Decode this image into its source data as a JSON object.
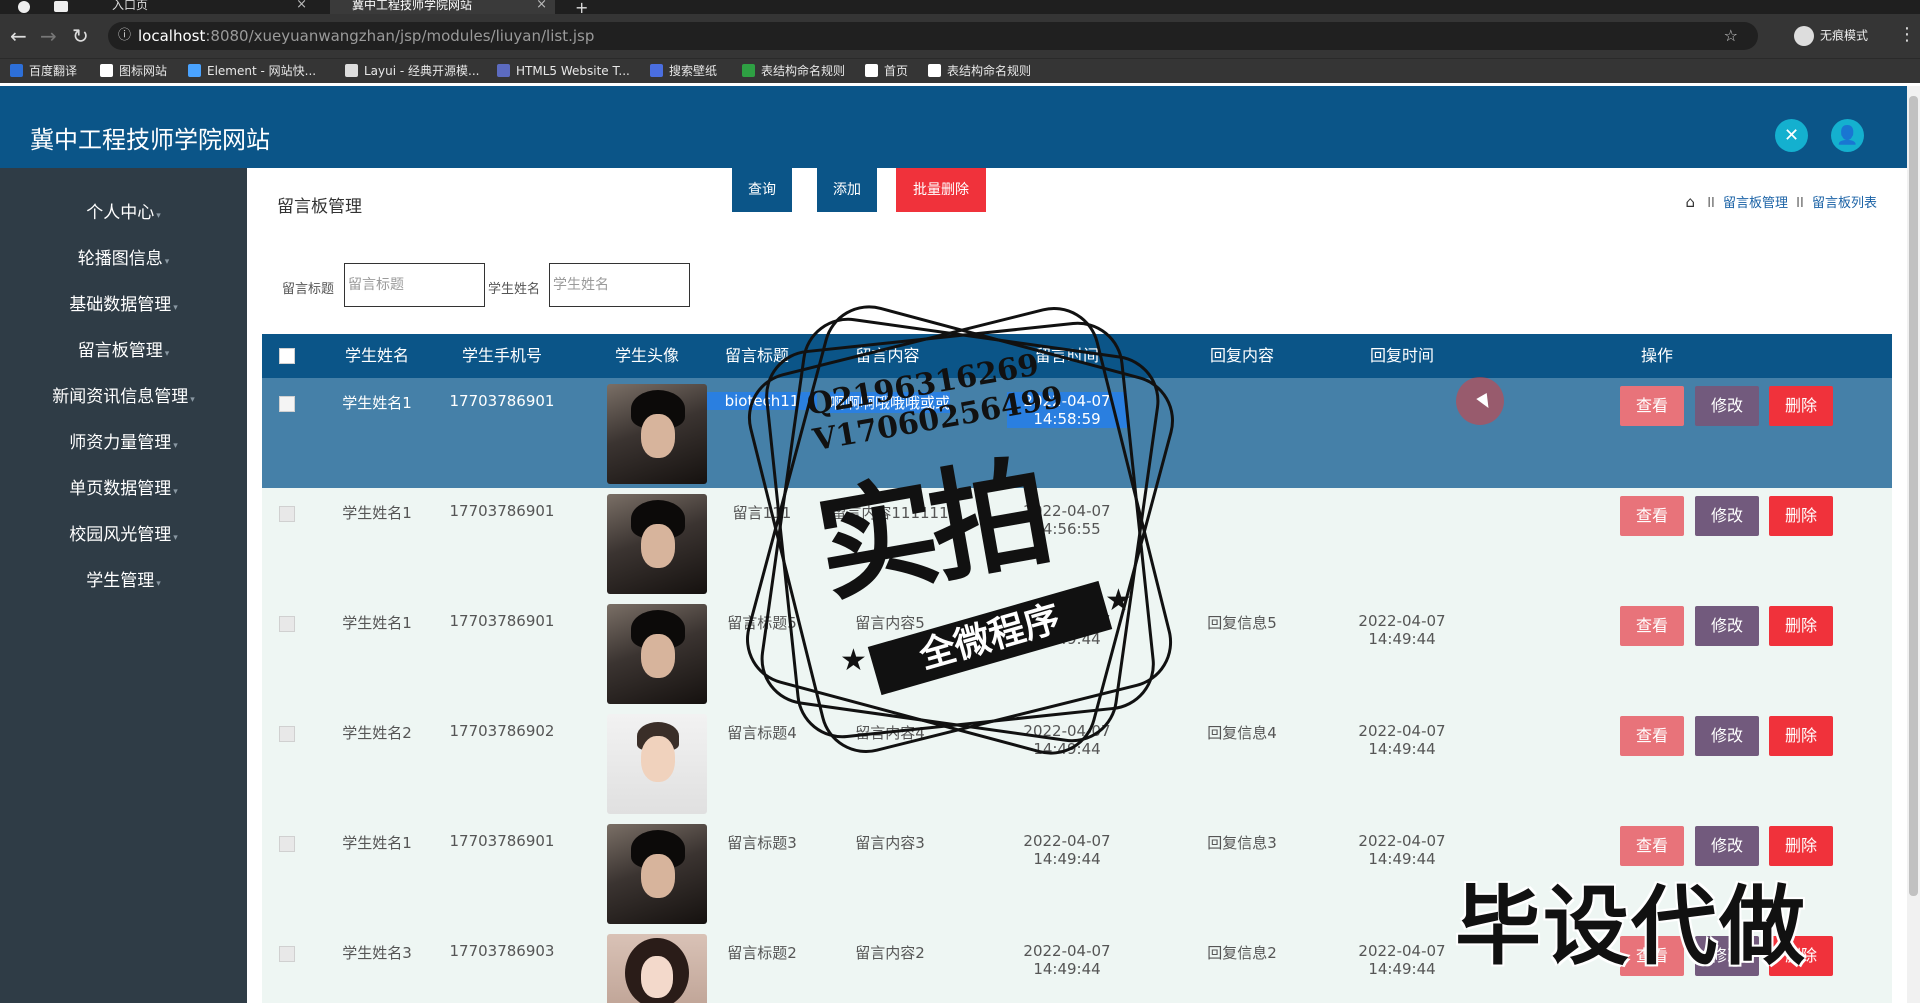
{
  "browser": {
    "tabs": [
      {
        "title": "入口页"
      },
      {
        "title": "冀中工程技师学院网站"
      }
    ],
    "url": {
      "host": "localhost",
      "path": ":8080/xueyuanwangzhan/jsp/modules/liuyan/list.jsp"
    },
    "incognito_label": "无痕模式",
    "bookmarks": [
      {
        "label": "百度翻译",
        "color": "#2d6fd8"
      },
      {
        "label": "图标网站",
        "color": "#ffffff"
      },
      {
        "label": "Element - 网站快...",
        "color": "#4aa3ff"
      },
      {
        "label": "Layui - 经典开源模...",
        "color": "#dddddd"
      },
      {
        "label": "HTML5 Website T...",
        "color": "#5c6bc0"
      },
      {
        "label": "搜索壁纸",
        "color": "#4a6ee0"
      },
      {
        "label": "表结构命名规则",
        "color": "#2ea043"
      },
      {
        "label": "首页",
        "color": "#ffffff"
      },
      {
        "label": "表结构命名规则",
        "color": "#ffffff"
      }
    ]
  },
  "header": {
    "site_title": "冀中工程技师学院网站",
    "accent": "#0b5588",
    "button_color": "#14b0cf"
  },
  "sidebar": {
    "items": [
      {
        "label": "个人中心"
      },
      {
        "label": "轮播图信息"
      },
      {
        "label": "基础数据管理"
      },
      {
        "label": "留言板管理"
      },
      {
        "label": "新闻资讯信息管理"
      },
      {
        "label": "师资力量管理"
      },
      {
        "label": "单页数据管理"
      },
      {
        "label": "校园风光管理"
      },
      {
        "label": "学生管理"
      }
    ]
  },
  "main": {
    "page_title": "留言板管理",
    "breadcrumb": [
      "留言板管理",
      "留言板列表"
    ],
    "breadcrumb_sep": "II",
    "filters": {
      "title_label": "留言标题",
      "title_placeholder": "留言标题",
      "name_label": "学生姓名",
      "name_placeholder": "学生姓名"
    },
    "buttons": {
      "query": "查询",
      "add": "添加",
      "batch_delete": "批量删除"
    },
    "table": {
      "headers": [
        "学生姓名",
        "学生手机号",
        "学生头像",
        "留言标题",
        "留言内容",
        "留言时间",
        "回复内容",
        "回复时间",
        "操作"
      ],
      "actions": {
        "view": "查看",
        "edit": "修改",
        "delete": "删除"
      },
      "rows": [
        {
          "name": "学生姓名1",
          "phone": "17703786901",
          "avatar": "dark",
          "title": "biotech11",
          "content": "啊啊啊哦哦哦或或",
          "time": "2022-04-07 14:58:59",
          "reply": "",
          "reply_time": "",
          "selected": true
        },
        {
          "name": "学生姓名1",
          "phone": "17703786901",
          "avatar": "dark",
          "title": "留言111",
          "content": "留言内容111111",
          "time": "2022-04-07 14:56:55",
          "reply": "",
          "reply_time": "",
          "selected": false
        },
        {
          "name": "学生姓名1",
          "phone": "17703786901",
          "avatar": "dark",
          "title": "留言标题5",
          "content": "留言内容5",
          "time": "2022-04-07 14:49:44",
          "reply": "回复信息5",
          "reply_time": "2022-04-07 14:49:44",
          "selected": false
        },
        {
          "name": "学生姓名2",
          "phone": "17703786902",
          "avatar": "light",
          "title": "留言标题4",
          "content": "留言内容4",
          "time": "2022-04-07 14:49:44",
          "reply": "回复信息4",
          "reply_time": "2022-04-07 14:49:44",
          "selected": false
        },
        {
          "name": "学生姓名1",
          "phone": "17703786901",
          "avatar": "dark",
          "title": "留言标题3",
          "content": "留言内容3",
          "time": "2022-04-07 14:49:44",
          "reply": "回复信息3",
          "reply_time": "2022-04-07 14:49:44",
          "selected": false
        },
        {
          "name": "学生姓名3",
          "phone": "17703786903",
          "avatar": "girl",
          "title": "留言标题2",
          "content": "留言内容2",
          "time": "2022-04-07 14:49:44",
          "reply": "回复信息2",
          "reply_time": "2022-04-07 14:49:44",
          "selected": false
        }
      ]
    }
  },
  "watermark": {
    "contact": "Q2196316269 V17060256499",
    "main_text": "实拍",
    "banner_text": "全微程序",
    "corner_text": "毕设代做"
  },
  "colors": {
    "sidebar_bg": "#2f3c46",
    "selected_row": "#4580a8",
    "view_button": "#e8737a",
    "edit_button": "#725a7d",
    "delete_button": "#f0323b",
    "batch_delete_button": "#f0323b",
    "query_button": "#0b5588"
  }
}
